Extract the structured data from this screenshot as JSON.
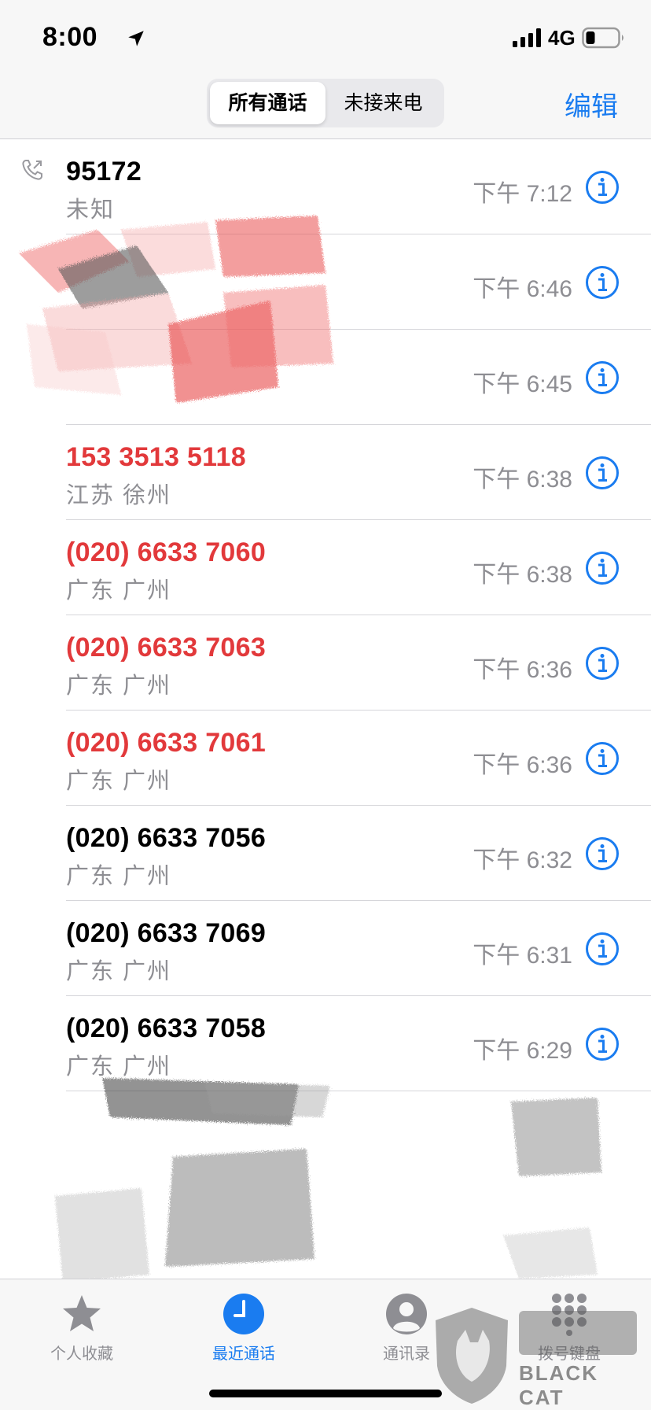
{
  "status_bar": {
    "time": "8:00",
    "network": "4G"
  },
  "nav": {
    "segments": [
      "所有通话",
      "未接来电"
    ],
    "active_segment": 0,
    "edit_label": "编辑"
  },
  "calls": [
    {
      "number": "95172",
      "label": "未知",
      "time": "下午 7:12",
      "missed": false,
      "outgoing": true
    },
    {
      "number": "",
      "label": "",
      "time": "下午 6:46",
      "missed": false,
      "outgoing": false
    },
    {
      "number": "",
      "label": "",
      "time": "下午 6:45",
      "missed": false,
      "outgoing": false
    },
    {
      "number": "153 3513 5118",
      "label": "江苏 徐州",
      "time": "下午 6:38",
      "missed": true,
      "outgoing": false
    },
    {
      "number": "(020) 6633 7060",
      "label": "广东 广州",
      "time": "下午 6:38",
      "missed": true,
      "outgoing": false
    },
    {
      "number": "(020) 6633 7063",
      "label": "广东 广州",
      "time": "下午 6:36",
      "missed": true,
      "outgoing": false
    },
    {
      "number": "(020) 6633 7061",
      "label": "广东 广州",
      "time": "下午 6:36",
      "missed": true,
      "outgoing": false
    },
    {
      "number": "(020) 6633 7056",
      "label": "广东 广州",
      "time": "下午 6:32",
      "missed": false,
      "outgoing": false
    },
    {
      "number": "(020) 6633 7069",
      "label": "广东 广州",
      "time": "下午 6:31",
      "missed": false,
      "outgoing": false
    },
    {
      "number": "(020) 6633 7058",
      "label": "广东 广州",
      "time": "下午 6:29",
      "missed": false,
      "outgoing": false
    }
  ],
  "tab_bar": {
    "tabs": [
      {
        "label": "个人收藏",
        "icon": "star-icon"
      },
      {
        "label": "最近通话",
        "icon": "clock-icon"
      },
      {
        "label": "通讯录",
        "icon": "person-icon"
      },
      {
        "label": "拨号键盘",
        "icon": "keypad-icon"
      }
    ],
    "active_tab": 1
  },
  "watermark": {
    "text": "BLACK CAT",
    "logo_text": "黑猫"
  },
  "colors": {
    "accent": "#1a7cf0",
    "missed": "#e2393b",
    "secondary_text": "#8e8e93"
  }
}
